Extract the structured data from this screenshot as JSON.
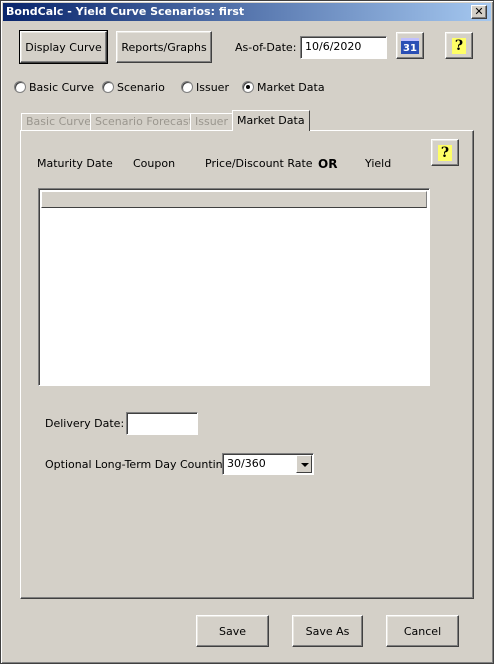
{
  "window": {
    "title": "BondCalc - Yield Curve Scenarios: first",
    "close_glyph": "✕"
  },
  "toolbar": {
    "display_curve": "Display Curve",
    "reports_graphs": "Reports/Graphs",
    "as_of_label": "As-of-Date:",
    "as_of_value": "10/6/2020",
    "calendar_icon": "calendar-icon",
    "calendar_glyph": "31",
    "help_icon": "help-icon",
    "help_glyph": "?"
  },
  "radios": [
    {
      "label": "Basic Curve",
      "selected": false
    },
    {
      "label": "Scenario",
      "selected": false
    },
    {
      "label": "Issuer",
      "selected": false
    },
    {
      "label": "Market Data",
      "selected": true
    }
  ],
  "tabs": [
    {
      "label": "Basic Curve",
      "enabled": false
    },
    {
      "label": "Scenario Forecast",
      "enabled": false
    },
    {
      "label": "Issuer",
      "enabled": false
    },
    {
      "label": "Market Data",
      "enabled": true,
      "active": true
    }
  ],
  "market_data": {
    "col_maturity": "Maturity Date",
    "col_coupon": "Coupon",
    "col_price": "Price/Discount Rate",
    "or_text": "OR",
    "col_yield": "Yield",
    "help_glyph": "?",
    "delivery_label": "Delivery Date:",
    "delivery_value": "",
    "daycount_label": "Optional Long-Term Day Counting:",
    "daycount_value": "30/360"
  },
  "footer": {
    "save": "Save",
    "save_as": "Save As",
    "cancel": "Cancel"
  }
}
